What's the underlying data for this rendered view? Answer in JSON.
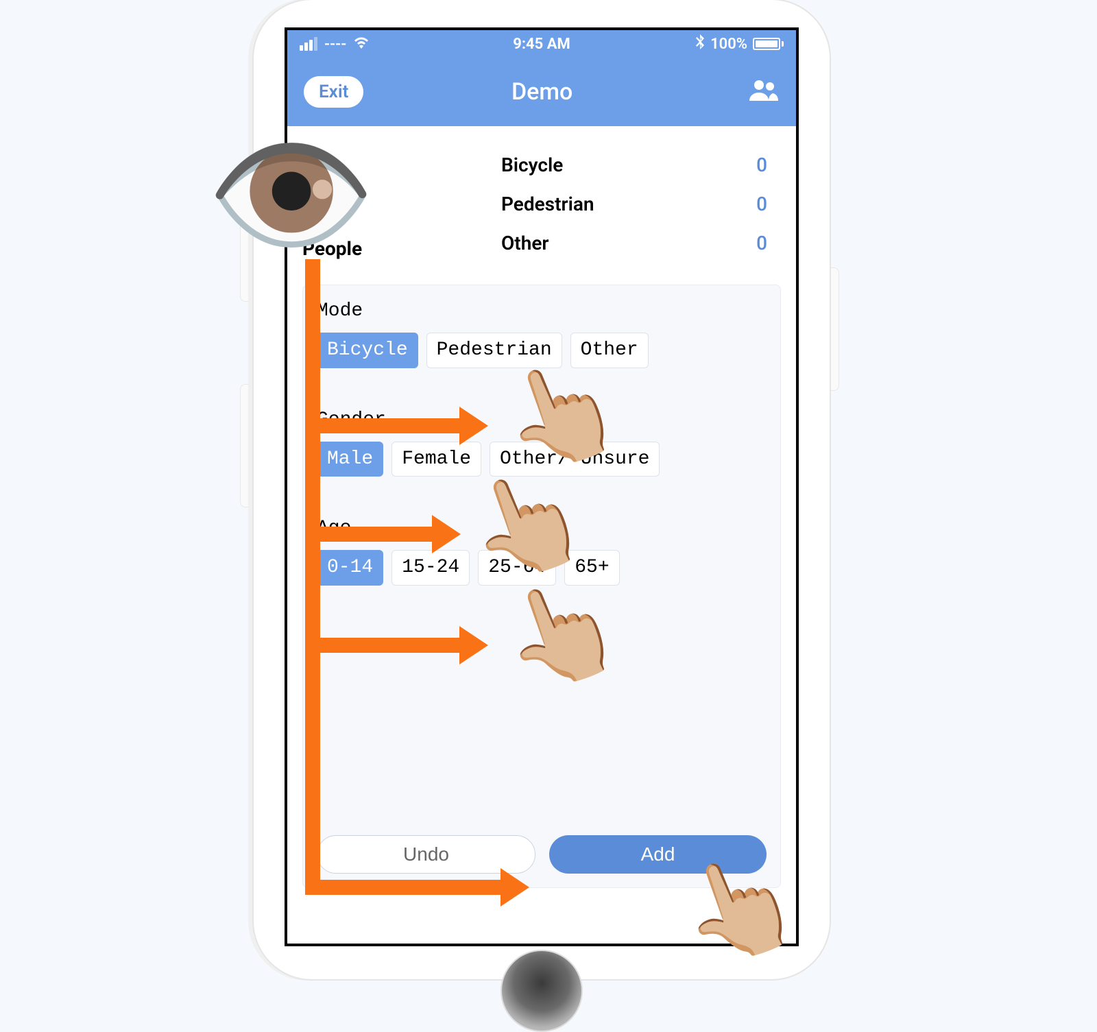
{
  "statusbar": {
    "carrier": "----",
    "time": "9:45 AM",
    "battery_pct": "100%"
  },
  "header": {
    "exit_label": "Exit",
    "title": "Demo"
  },
  "people_label": "People",
  "counts": {
    "bicycle_label": "Bicycle",
    "bicycle_val": "0",
    "pedestrian_label": "Pedestrian",
    "pedestrian_val": "0",
    "other_label": "Other",
    "other_val": "0"
  },
  "mode": {
    "label": "Mode",
    "options": {
      "bicycle": "Bicycle",
      "pedestrian": "Pedestrian",
      "other": "Other"
    }
  },
  "gender": {
    "label": "Gender",
    "options": {
      "male": "Male",
      "female": "Female",
      "other": "Other/ Unsure"
    }
  },
  "age": {
    "label": "Age",
    "options": {
      "a0_14": "0-14",
      "a15_24": "15-24",
      "a25_64": "25-64",
      "a65p": "65+"
    }
  },
  "buttons": {
    "undo": "Undo",
    "add": "Add"
  }
}
